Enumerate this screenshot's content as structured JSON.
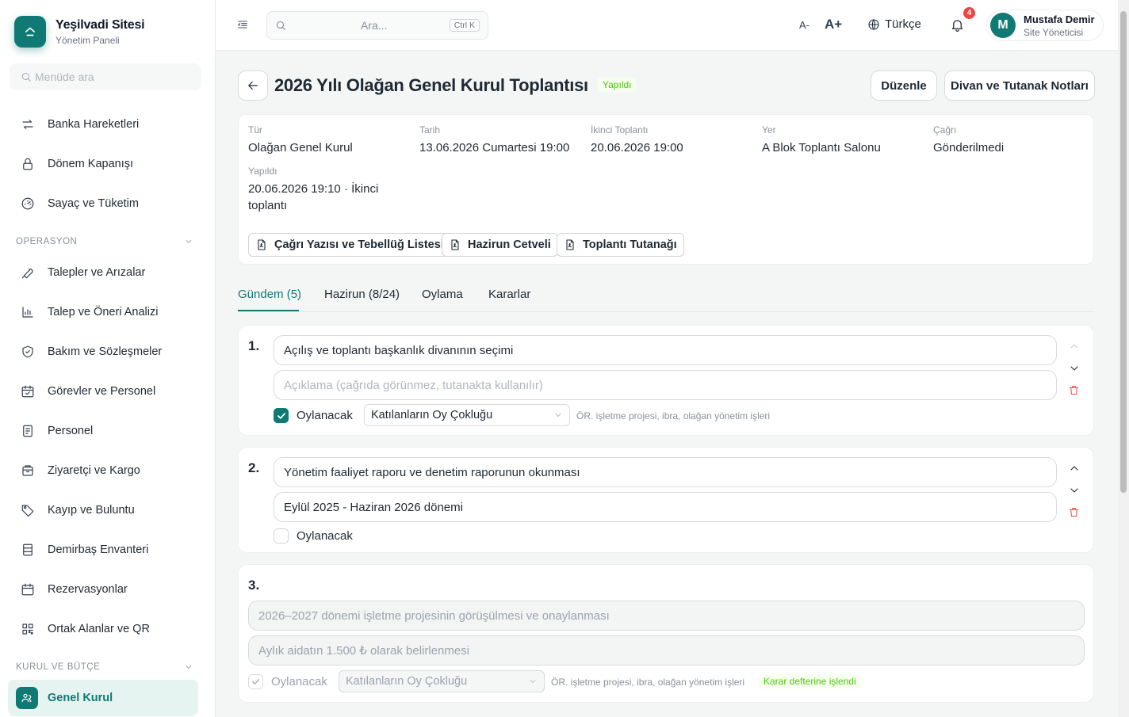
{
  "brand": {
    "name": "Yeşilvadi Sitesi",
    "subtitle": "Yönetim Paneli"
  },
  "menu_search": {
    "placeholder": "Menüde ara"
  },
  "nav": {
    "items_top": [
      {
        "label": "Banka Hareketleri",
        "icon": "transfer-icon"
      },
      {
        "label": "Dönem Kapanışı",
        "icon": "lock-icon"
      },
      {
        "label": "Sayaç ve Tüketim",
        "icon": "gauge-icon"
      }
    ],
    "section_operasyon": "OPERASYON",
    "items_operasyon": [
      {
        "label": "Talepler ve Arızalar",
        "icon": "wrench-icon"
      },
      {
        "label": "Talep ve Öneri Analizi",
        "icon": "bar-chart-icon"
      },
      {
        "label": "Bakım ve Sözleşmeler",
        "icon": "shield-icon"
      },
      {
        "label": "Görevler ve Personel",
        "icon": "calendar-check-icon"
      },
      {
        "label": "Personel",
        "icon": "id-badge-icon"
      },
      {
        "label": "Ziyaretçi ve Kargo",
        "icon": "package-icon"
      },
      {
        "label": "Kayıp ve Buluntu",
        "icon": "tag-icon"
      },
      {
        "label": "Demirbaş Envanteri",
        "icon": "inventory-icon"
      },
      {
        "label": "Rezervasyonlar",
        "icon": "calendar-icon"
      },
      {
        "label": "Ortak Alanlar ve QR",
        "icon": "qr-code-icon"
      }
    ],
    "section_kurul": "KURUL VE BÜTÇE",
    "active_item": {
      "label": "Genel Kurul",
      "icon": "people-icon"
    }
  },
  "header": {
    "search_placeholder": "Ara...",
    "search_shortcut": "Ctrl K",
    "font_decrease": "A-",
    "font_increase": "A+",
    "language": "Türkçe",
    "notification_count": "4",
    "user": {
      "initial": "M",
      "name": "Mustafa Demir",
      "role": "Site Yöneticisi"
    }
  },
  "page": {
    "title": "2026 Yılı Olağan Genel Kurul Toplantısı",
    "status": "Yapıldı",
    "edit_button": "Düzenle",
    "notes_button": "Divan ve Tutanak Notları"
  },
  "info": {
    "type": {
      "label": "Tür",
      "value": "Olağan Genel Kurul"
    },
    "date": {
      "label": "Tarih",
      "value": "13.06.2026 Cumartesi 19:00"
    },
    "second": {
      "label": "İkinci Toplantı",
      "value": "20.06.2026 19:00"
    },
    "place": {
      "label": "Yer",
      "value": "A Blok Toplantı Salonu"
    },
    "call": {
      "label": "Çağrı",
      "value": "Gönderilmedi"
    },
    "held": {
      "label": "Yapıldı",
      "value": "20.06.2026 19:10 · İkinci toplantı"
    },
    "docs": [
      "Çağrı Yazısı ve Tebellüğ Listesi",
      "Hazirun Cetveli",
      "Toplantı Tutanağı"
    ]
  },
  "tabs": [
    "Gündem (5)",
    "Hazirun (8/24)",
    "Oylama",
    "Kararlar"
  ],
  "agenda": [
    {
      "number": "1.",
      "title": "Açılış ve toplantı başkanlık divanının seçimi",
      "description_placeholder": "Açıklama (çağrıda görünmez, tutanakta kullanılır)",
      "vote_label": "Oylanacak",
      "voted": true,
      "majority": "Katılanların Oy Çokluğu",
      "hint": "ÖR. işletme projesi, ibra, olağan yönetim işleri"
    },
    {
      "number": "2.",
      "title": "Yönetim faaliyet raporu ve denetim raporunun okunması",
      "description": "Eylül 2025 - Haziran 2026 dönemi",
      "vote_label": "Oylanacak",
      "voted": false
    },
    {
      "number": "3.",
      "title": "2026–2027 dönemi işletme projesinin görüşülmesi ve onaylanması",
      "description": "Aylık aidatın 1.500 ₺ olarak belirlenmesi",
      "vote_label": "Oylanacak",
      "voted": true,
      "majority": "Katılanların Oy Çokluğu",
      "hint": "ÖR. işletme projesi, ibra, olağan yönetim işleri",
      "decision": "Karar defterine işlendi"
    }
  ],
  "colors": {
    "accent": "#0f7a73",
    "success": "#52c41a",
    "danger": "#ef4444",
    "badge": "#ef4444"
  }
}
